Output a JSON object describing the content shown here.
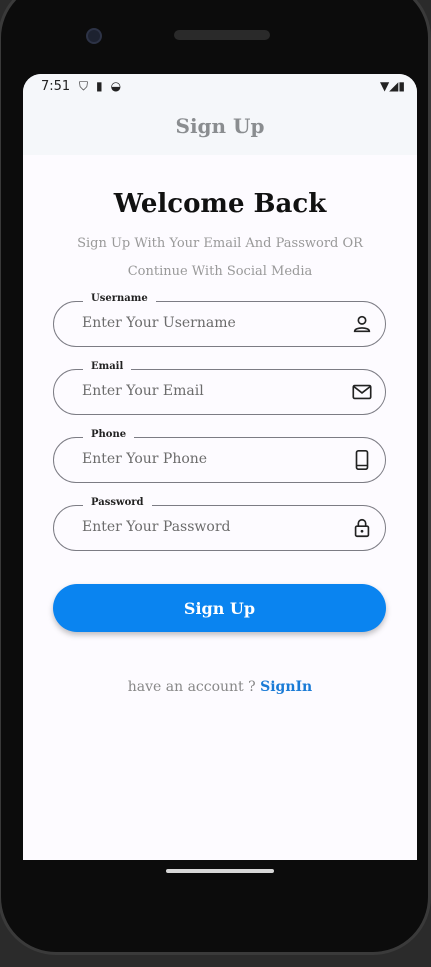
{
  "status_bar": {
    "time": "7:51"
  },
  "app_bar": {
    "title": "Sign Up"
  },
  "heading": "Welcome Back",
  "subtitle_line1": "Sign Up With Your Email And Password OR",
  "subtitle_line2": "Continue With Social Media",
  "fields": [
    {
      "label": "Username",
      "placeholder": "Enter Your Username",
      "icon": "person-icon"
    },
    {
      "label": "Email",
      "placeholder": "Enter Your Email",
      "icon": "mail-icon"
    },
    {
      "label": "Phone",
      "placeholder": "Enter Your Phone",
      "icon": "phone-icon"
    },
    {
      "label": "Password",
      "placeholder": "Enter Your Password",
      "icon": "lock-icon"
    }
  ],
  "signup_button": {
    "label": "Sign Up",
    "color": "#0a84f0"
  },
  "footer": {
    "prompt": "have an account ?",
    "link": "SignIn",
    "link_color": "#1a7bd6"
  }
}
